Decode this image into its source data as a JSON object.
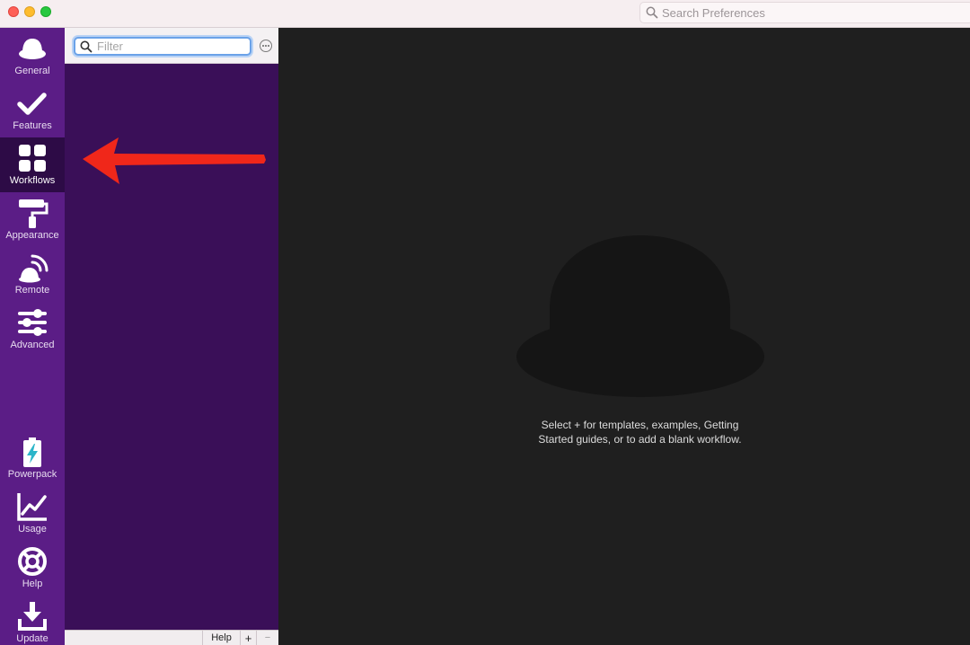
{
  "titlebar": {
    "search_placeholder": "Search Preferences"
  },
  "sidebar": {
    "items": [
      {
        "label": "General",
        "icon": "hat-icon",
        "active": false
      },
      {
        "label": "Features",
        "icon": "checkmark-icon",
        "active": false
      },
      {
        "label": "Workflows",
        "icon": "grid-icon",
        "active": true
      },
      {
        "label": "Appearance",
        "icon": "paint-roller-icon",
        "active": false
      },
      {
        "label": "Remote",
        "icon": "remote-icon",
        "active": false
      },
      {
        "label": "Advanced",
        "icon": "sliders-icon",
        "active": false
      },
      {
        "label": "Powerpack",
        "icon": "battery-bolt-icon",
        "active": false
      },
      {
        "label": "Usage",
        "icon": "line-chart-icon",
        "active": false
      },
      {
        "label": "Help",
        "icon": "lifebuoy-icon",
        "active": false
      },
      {
        "label": "Update",
        "icon": "download-icon",
        "active": false
      }
    ]
  },
  "workflows": {
    "filter_placeholder": "Filter",
    "footer": {
      "help_label": "Help",
      "add_label": "+",
      "remove_label": "−"
    }
  },
  "main": {
    "empty_line1": "Select + for templates, examples, Getting",
    "empty_line2": "Started guides, or to add a blank workflow."
  },
  "colors": {
    "sidebar_bg": "#5b1d86",
    "sidebar_active": "#2d0b46",
    "list_bg": "#3a0f58",
    "main_bg": "#1f1f1f",
    "arrow": "#f0271a"
  }
}
